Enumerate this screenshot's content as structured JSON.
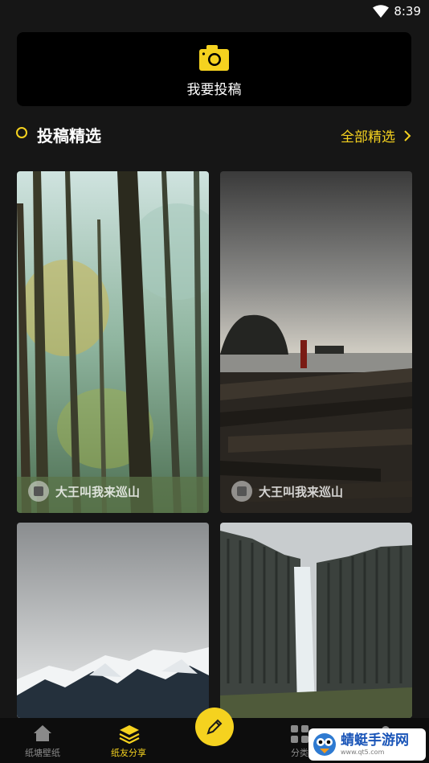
{
  "status_bar": {
    "time": "8:39"
  },
  "submit": {
    "label": "我要投稿",
    "icon": "camera-icon"
  },
  "section": {
    "title": "投稿精选",
    "see_all": "全部精选"
  },
  "posts": [
    {
      "author": "大王叫我来巡山",
      "scene": "forest"
    },
    {
      "author": "大王叫我来巡山",
      "scene": "coast-driftwood"
    },
    {
      "author": "",
      "scene": "snowy-mountain"
    },
    {
      "author": "",
      "scene": "waterfall-basalt"
    }
  ],
  "tabbar": {
    "tabs": [
      {
        "label": "纸塘壁纸",
        "icon": "home-icon"
      },
      {
        "label": "纸友分享",
        "icon": "layers-icon",
        "active": true
      },
      {
        "label": "",
        "icon": "edit-icon"
      },
      {
        "label": "分类",
        "icon": "grid-icon"
      },
      {
        "label": "",
        "icon": "profile-icon"
      }
    ]
  },
  "watermark": {
    "name": "蜻蜓手游网",
    "url": "www.qt5.com"
  },
  "colors": {
    "accent": "#f5d21f",
    "background": "#161616",
    "card": "#000000"
  }
}
